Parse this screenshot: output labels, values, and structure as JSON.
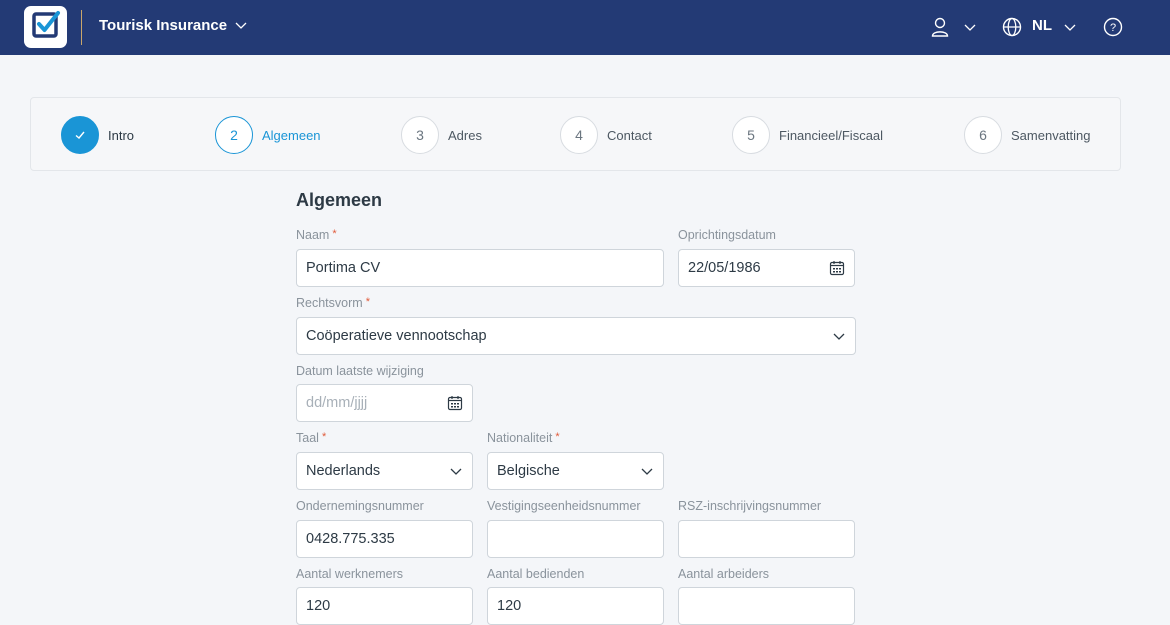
{
  "header": {
    "app_title": "Tourisk Insurance",
    "language": "NL",
    "brand_color": "#233a75",
    "icons": [
      "checkbox-logo-icon",
      "chevron-down-icon",
      "user-icon",
      "globe-icon",
      "help-icon"
    ]
  },
  "stepper": {
    "steps": [
      {
        "number": "",
        "label": "Intro",
        "state": "done"
      },
      {
        "number": "2",
        "label": "Algemeen",
        "state": "active"
      },
      {
        "number": "3",
        "label": "Adres",
        "state": "todo"
      },
      {
        "number": "4",
        "label": "Contact",
        "state": "todo"
      },
      {
        "number": "5",
        "label": "Financieel/Fiscaal",
        "state": "todo"
      },
      {
        "number": "6",
        "label": "Samenvatting",
        "state": "todo"
      }
    ],
    "accent_color": "#1a95d6"
  },
  "form": {
    "title": "Algemeen",
    "naam": {
      "label": "Naam",
      "required": "*",
      "value": "Portima CV"
    },
    "oprichtingsdatum": {
      "label": "Oprichtingsdatum",
      "value": "22/05/1986"
    },
    "rechtsvorm": {
      "label": "Rechtsvorm",
      "required": "*",
      "value": "Coöperatieve vennootschap"
    },
    "datum_laatste_wijziging": {
      "label": "Datum laatste wijziging",
      "placeholder": "dd/mm/jjjj"
    },
    "taal": {
      "label": "Taal",
      "required": "*",
      "value": "Nederlands"
    },
    "nationaliteit": {
      "label": "Nationaliteit",
      "required": "*",
      "value": "Belgische"
    },
    "ondernemingsnummer": {
      "label": "Ondernemingsnummer",
      "value": "0428.775.335"
    },
    "vestigingseenheidsnummer": {
      "label": "Vestigingseenheidsnummer",
      "value": ""
    },
    "rsz_inschrijvingsnummer": {
      "label": "RSZ-inschrijvingsnummer",
      "value": ""
    },
    "aantal_werknemers": {
      "label": "Aantal werknemers",
      "value": "120"
    },
    "aantal_bedienden": {
      "label": "Aantal bedienden",
      "value": "120"
    },
    "aantal_arbeiders": {
      "label": "Aantal arbeiders",
      "value": ""
    }
  }
}
